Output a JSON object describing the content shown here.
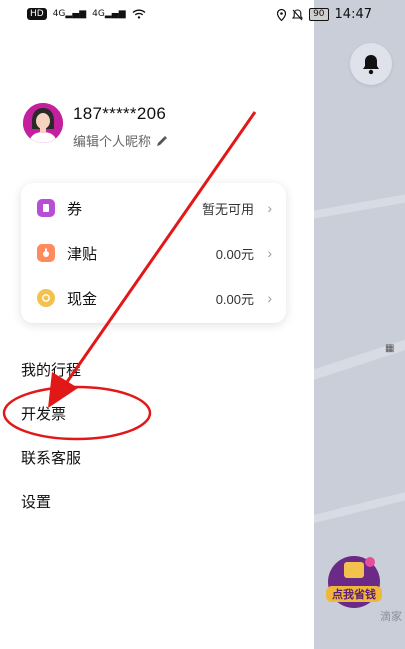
{
  "statusbar": {
    "left_hd": "HD",
    "left_net1": "4G",
    "left_net2": "4G",
    "battery": "90",
    "time": "14:47"
  },
  "profile": {
    "phone": "187*****206",
    "edit_nickname": "编辑个人昵称"
  },
  "wallet": {
    "items": [
      {
        "label": "券",
        "value": "暂无可用",
        "icon": "coupon-icon",
        "color": "#b84ed6"
      },
      {
        "label": "津贴",
        "value": "0.00元",
        "icon": "allowance-icon",
        "color": "#ff8a5c"
      },
      {
        "label": "现金",
        "value": "0.00元",
        "icon": "cash-icon",
        "color": "#f2c14e"
      }
    ]
  },
  "menu": {
    "items": [
      {
        "label": "我的行程",
        "name": "menu-item-my-trips"
      },
      {
        "label": "开发票",
        "name": "menu-item-invoice"
      },
      {
        "label": "联系客服",
        "name": "menu-item-customer-service"
      },
      {
        "label": "设置",
        "name": "menu-item-settings"
      }
    ]
  },
  "map": {
    "promo_text": "点我省钱",
    "side_text": "滴家"
  },
  "colors": {
    "annotation": "#e21818",
    "avatar_bg": "#c41f9d",
    "map_bg": "#c9ced9"
  }
}
